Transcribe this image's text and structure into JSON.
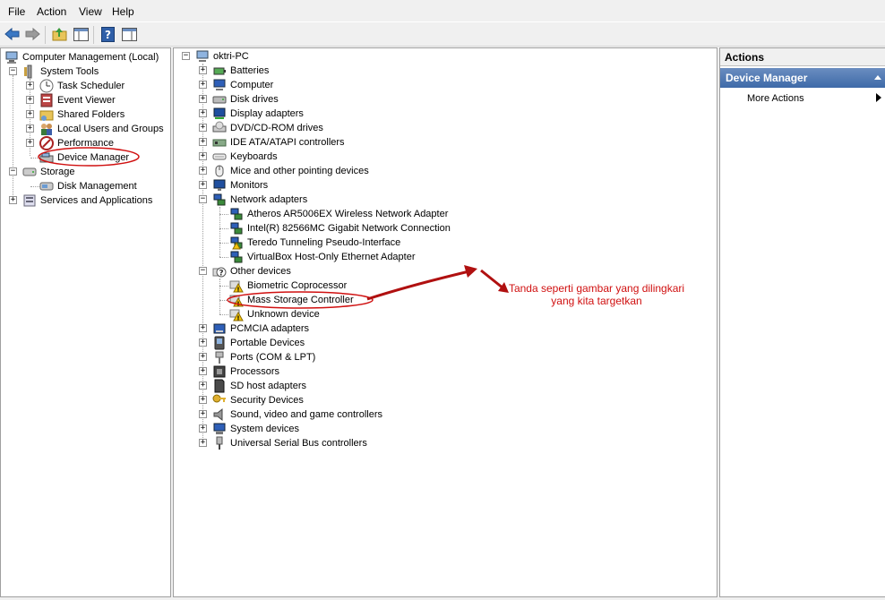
{
  "menu": [
    "File",
    "Action",
    "View",
    "Help"
  ],
  "left_tree": {
    "root": "Computer Management (Local)",
    "system_tools": "System Tools",
    "task_scheduler": "Task Scheduler",
    "event_viewer": "Event Viewer",
    "shared_folders": "Shared Folders",
    "local_users": "Local Users and Groups",
    "performance": "Performance",
    "device_manager": "Device Manager",
    "storage": "Storage",
    "disk_management": "Disk Management",
    "services": "Services and Applications"
  },
  "device_tree": {
    "computer": "oktri-PC",
    "categories": {
      "batteries": "Batteries",
      "computer": "Computer",
      "disk_drives": "Disk drives",
      "display": "Display adapters",
      "dvd": "DVD/CD-ROM drives",
      "ide": "IDE ATA/ATAPI controllers",
      "keyboards": "Keyboards",
      "mice": "Mice and other pointing devices",
      "monitors": "Monitors",
      "network": "Network adapters",
      "other": "Other devices",
      "pcmcia": "PCMCIA adapters",
      "portable": "Portable Devices",
      "ports": "Ports (COM & LPT)",
      "processors": "Processors",
      "sd": "SD host adapters",
      "security": "Security Devices",
      "sound": "Sound, video and game controllers",
      "system": "System devices",
      "usb": "Universal Serial Bus controllers"
    },
    "network_children": [
      "Atheros AR5006EX Wireless Network Adapter",
      "Intel(R) 82566MC Gigabit Network Connection",
      "Teredo Tunneling Pseudo-Interface",
      "VirtualBox Host-Only Ethernet Adapter"
    ],
    "other_children": [
      "Biometric Coprocessor",
      "Mass Storage Controller",
      "Unknown device"
    ]
  },
  "actions": {
    "header": "Actions",
    "selected": "Device Manager",
    "more": "More Actions"
  },
  "annotation": {
    "line1": "Tanda seperti gambar yang dilingkari",
    "line2": "yang kita targetkan",
    "color": "#d01010"
  }
}
